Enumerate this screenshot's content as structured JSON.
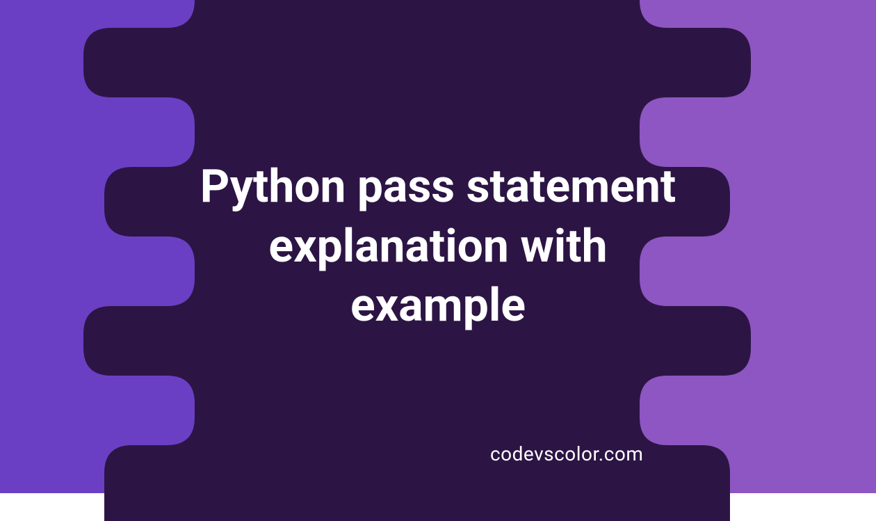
{
  "title": "Python pass statement explanation with example",
  "watermark": "codevscolor.com",
  "colors": {
    "bg_left": "#6a3fc4",
    "bg_right": "#8e56c2",
    "blob": "#2c1544",
    "text": "#ffffff"
  }
}
